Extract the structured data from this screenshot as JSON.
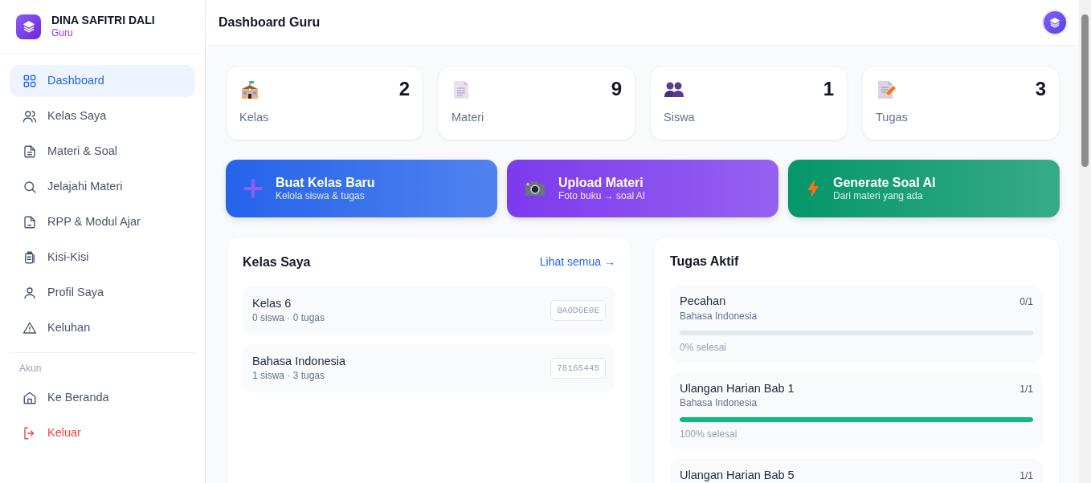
{
  "sidebar": {
    "brand": {
      "name": "DINA SAFITRI DALI",
      "role": "Guru"
    },
    "items": [
      {
        "label": "Dashboard",
        "selected": true
      },
      {
        "label": "Kelas Saya",
        "selected": false
      },
      {
        "label": "Materi & Soal",
        "selected": false
      },
      {
        "label": "Jelajahi Materi",
        "selected": false
      },
      {
        "label": "RPP & Modul Ajar",
        "selected": false
      },
      {
        "label": "Kisi-Kisi",
        "selected": false
      },
      {
        "label": "Profil Saya",
        "selected": false
      },
      {
        "label": "Keluhan",
        "selected": false
      }
    ],
    "section_label": "Akun",
    "account_items": [
      {
        "label": "Ke Beranda",
        "kind": "link"
      },
      {
        "label": "Keluar",
        "kind": "danger"
      }
    ]
  },
  "header": {
    "title": "Dashboard Guru"
  },
  "stats": [
    {
      "label": "Kelas",
      "value": "2"
    },
    {
      "label": "Materi",
      "value": "9"
    },
    {
      "label": "Siswa",
      "value": "1"
    },
    {
      "label": "Tugas",
      "value": "3"
    }
  ],
  "actions": [
    {
      "title": "Buat Kelas Baru",
      "subtitle": "Kelola siswa & tugas",
      "color": "#2563eb"
    },
    {
      "title": "Upload Materi",
      "subtitle": "Foto buku → soal AI",
      "color": "#7c3aed"
    },
    {
      "title": "Generate Soal AI",
      "subtitle": "Dari materi yang ada",
      "color": "#059669"
    }
  ],
  "classes_panel": {
    "title": "Kelas Saya",
    "link": "Lihat semua →",
    "classes": [
      {
        "name": "Kelas 6",
        "meta": "0 siswa · 0 tugas",
        "code": "8A0D6E0E"
      },
      {
        "name": "Bahasa Indonesia",
        "meta": "1 siswa · 3 tugas",
        "code": "78165445"
      }
    ]
  },
  "tasks_panel": {
    "title": "Tugas Aktif",
    "tasks": [
      {
        "title": "Pecahan",
        "subject": "Bahasa Indonesia",
        "count": "0/1",
        "level": 0,
        "progress": "0% selesai"
      },
      {
        "title": "Ulangan Harian Bab 1",
        "subject": "Bahasa Indonesia",
        "count": "1/1",
        "level": 1,
        "progress": "100% selesai"
      },
      {
        "title": "Ulangan Harian Bab 5",
        "count": "1/1"
      }
    ]
  }
}
